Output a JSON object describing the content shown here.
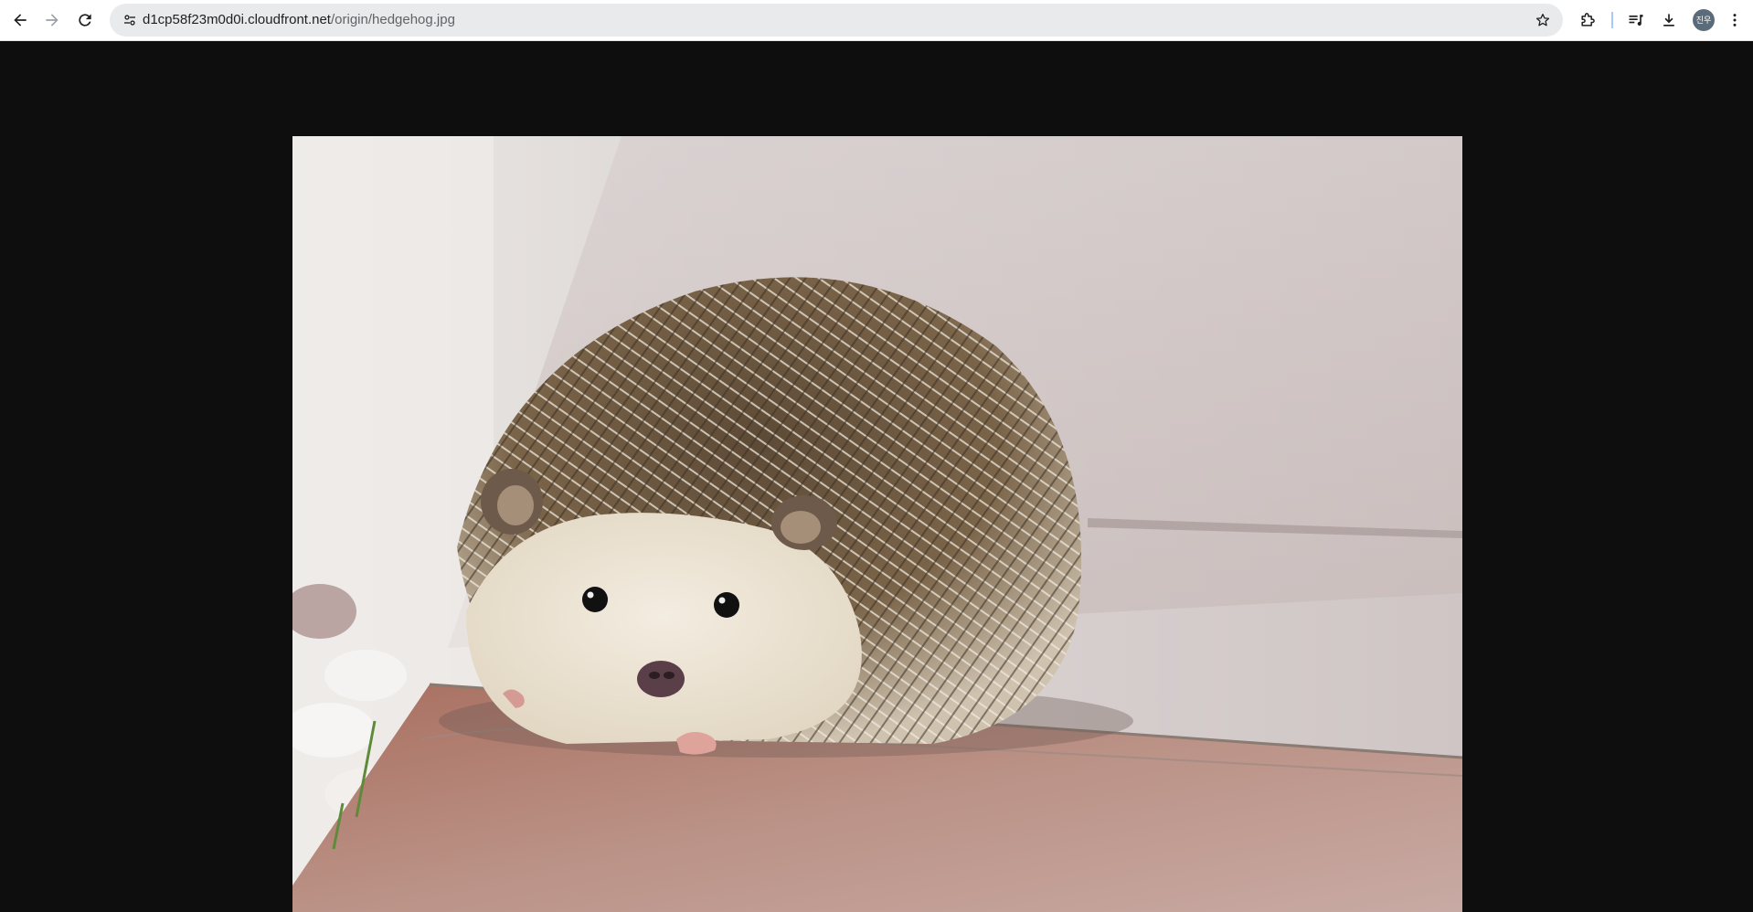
{
  "browser": {
    "url_host": "d1cp58f23m0d0i.cloudfront.net",
    "url_path": "/origin/hedgehog.jpg",
    "avatar_initials": "진우",
    "icons": {
      "back": "arrow-left-icon",
      "forward": "arrow-right-icon",
      "reload": "reload-icon",
      "site_info": "tune-icon",
      "bookmark": "star-icon",
      "extensions": "puzzle-icon",
      "media": "media-control-icon",
      "downloads": "download-icon",
      "menu": "kebab-menu-icon"
    }
  },
  "viewer": {
    "background": "#0e0e0e",
    "image_subject": "hedgehog"
  }
}
